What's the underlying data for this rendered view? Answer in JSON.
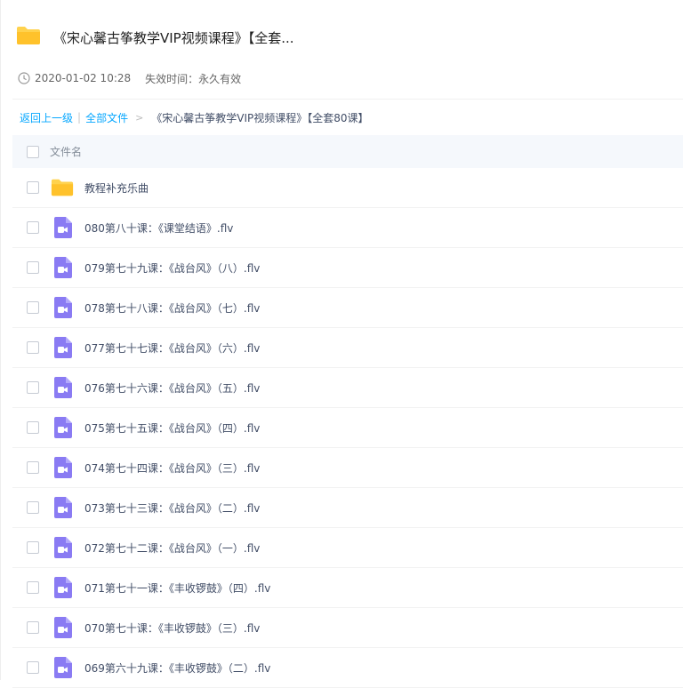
{
  "share": {
    "title": "《宋心馨古筝教学VIP视频课程》【全套...",
    "date": "2020-01-02 10:28",
    "expire_label": "失效时间：永久有效"
  },
  "breadcrumb": {
    "back": "返回上一级",
    "separator": "|",
    "all_files": "全部文件",
    "arrow": ">",
    "current": "《宋心馨古筝教学VIP视频课程》【全套80课】"
  },
  "list": {
    "column_filename": "文件名",
    "rows": [
      {
        "type": "folder",
        "name": "教程补充乐曲"
      },
      {
        "type": "video",
        "name": "080第八十课：《课堂结语》.flv"
      },
      {
        "type": "video",
        "name": "079第七十九课：《战台风》（八）.flv"
      },
      {
        "type": "video",
        "name": "078第七十八课：《战台风》（七）.flv"
      },
      {
        "type": "video",
        "name": "077第七十七课：《战台风》（六）.flv"
      },
      {
        "type": "video",
        "name": "076第七十六课：《战台风》（五）.flv"
      },
      {
        "type": "video",
        "name": "075第七十五课：《战台风》（四）.flv"
      },
      {
        "type": "video",
        "name": "074第七十四课：《战台风》（三）.flv"
      },
      {
        "type": "video",
        "name": "073第七十三课：《战台风》（二）.flv"
      },
      {
        "type": "video",
        "name": "072第七十二课：《战台风》（一）.flv"
      },
      {
        "type": "video",
        "name": "071第七十一课：《丰收锣鼓》（四）.flv"
      },
      {
        "type": "video",
        "name": "070第七十课：《丰收锣鼓》（三）.flv"
      },
      {
        "type": "video",
        "name": "069第六十九课：《丰收锣鼓》（二）.flv"
      }
    ]
  },
  "colors": {
    "folder": "#ffd24d",
    "video": "#8a7bf3",
    "link": "#06a7ff"
  }
}
